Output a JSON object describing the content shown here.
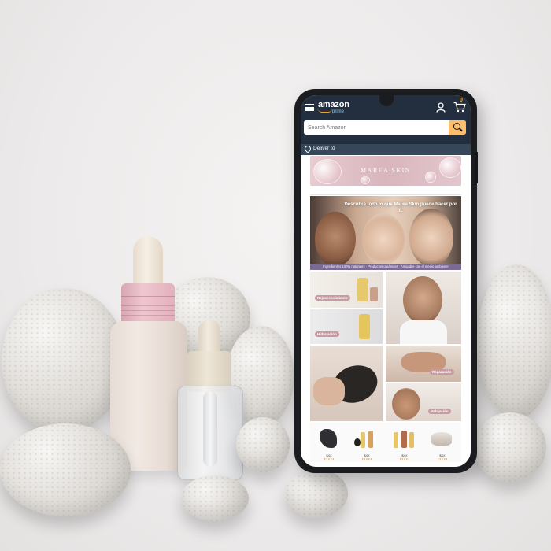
{
  "app": {
    "logo": "amazon",
    "logo_sub": "prime",
    "cart_count": "0",
    "search_placeholder": "Search Amazon",
    "deliver_label": "Deliver to"
  },
  "store": {
    "brand_banner": "MAREA SKIN",
    "hero_title": "Descubre todo lo que Marea Skin puede hacer por ti.",
    "hero_strip": "Ingredientes 100% naturales · Productos orgánicos · Amigable con el medio ambiente",
    "tiles": [
      {
        "label": "Rejuvenecimiento"
      },
      {
        "label": "Hidratación"
      },
      {
        "label": "Reparación"
      },
      {
        "label": "Relajación"
      }
    ],
    "products": [
      {
        "price": "$XX"
      },
      {
        "price": "$XX"
      },
      {
        "price": "$XX"
      },
      {
        "price": "$XX"
      }
    ]
  },
  "colors": {
    "topbar": "#232f3e",
    "search_button": "#febd69",
    "deliver_bar": "#37475a",
    "accent_strip": "#7b6a93",
    "banner_pink": "#d9b5bd"
  },
  "icons": [
    "menu-icon",
    "user-icon",
    "cart-icon",
    "search-icon",
    "location-pin-icon"
  ]
}
